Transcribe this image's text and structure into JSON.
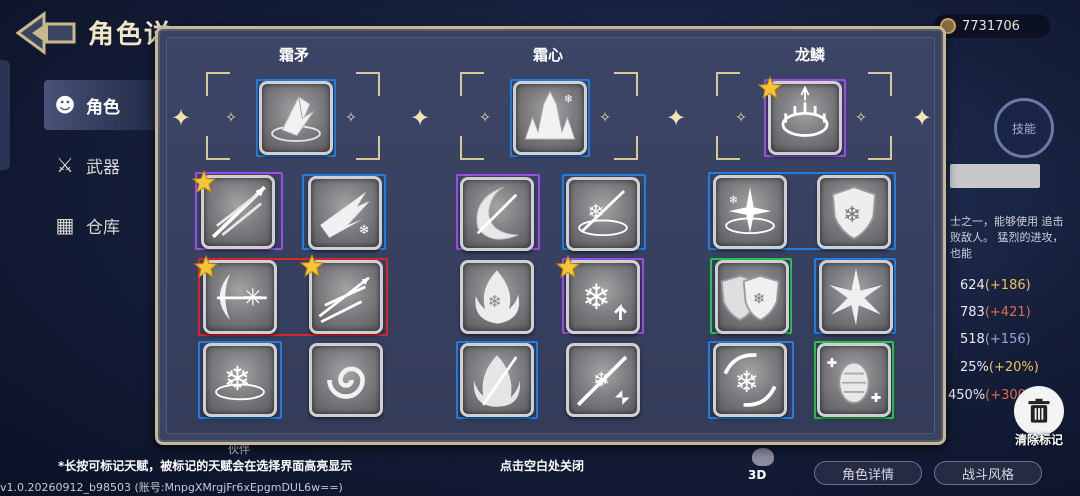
{
  "header": {
    "title": "角色详",
    "currency_value": "7731706"
  },
  "sidebar": {
    "items": [
      {
        "label": "角色",
        "icon": "character-icon",
        "active": true
      },
      {
        "label": "武器",
        "icon": "sword-icon",
        "active": false
      },
      {
        "label": "仓库",
        "icon": "chest-icon",
        "active": false
      }
    ]
  },
  "right_panel": {
    "compass_label": "技能",
    "description": "士之一，能够使用 追击败敌人。 猛烈的进攻，也能",
    "stats": [
      {
        "value": "624",
        "bonus": "(+186)"
      },
      {
        "value": "783",
        "bonus": "(+421)"
      },
      {
        "value": "518",
        "bonus": "(+156)"
      },
      {
        "value": "25%",
        "bonus": "(+20%)"
      },
      {
        "value": "450%",
        "bonus": "(+300%"
      }
    ],
    "clear_marks_label": "清除标记"
  },
  "talent_panel": {
    "columns": [
      {
        "title": "霜矛"
      },
      {
        "title": "霜心"
      },
      {
        "title": "龙鳞"
      }
    ]
  },
  "footer": {
    "hint": "*长按可标记天赋，被标记的天赋会在选择界面高亮显示",
    "close_hint": "点击空白处关闭",
    "version": "v1.0.20260912_b98503 (账号:MnpgXMrgjFr6xEpgmDUL6w==)",
    "three_d": "3D",
    "partner": "伙伴",
    "btn_details": "角色详情",
    "btn_style": "战斗风格"
  },
  "colors": {
    "frame_blue": "#1f7ee0",
    "frame_purple": "#9b4ee6",
    "frame_red": "#d8262a",
    "frame_green": "#26c64a",
    "panel_border": "#c7b79a"
  }
}
